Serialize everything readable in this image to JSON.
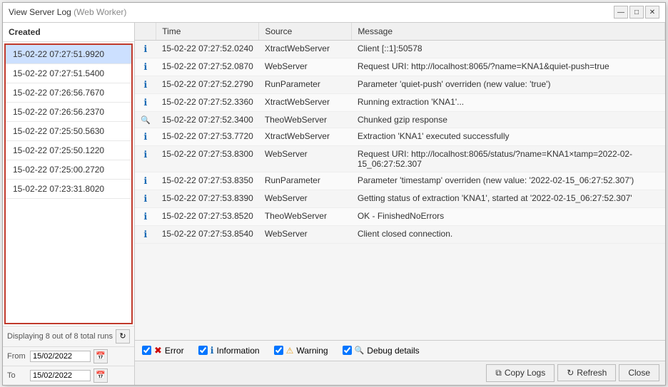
{
  "window": {
    "title": "View Server Log",
    "subtitle": "(Web Worker)"
  },
  "left_panel": {
    "header": "Created",
    "footer": "Displaying 8 out of 8 total runs",
    "runs": [
      {
        "id": 1,
        "label": "15-02-22 07:27:51.9920",
        "selected": true
      },
      {
        "id": 2,
        "label": "15-02-22 07:27:51.5400",
        "selected": false
      },
      {
        "id": 3,
        "label": "15-02-22 07:26:56.7670",
        "selected": false
      },
      {
        "id": 4,
        "label": "15-02-22 07:26:56.2370",
        "selected": false
      },
      {
        "id": 5,
        "label": "15-02-22 07:25:50.5630",
        "selected": false
      },
      {
        "id": 6,
        "label": "15-02-22 07:25:50.1220",
        "selected": false
      },
      {
        "id": 7,
        "label": "15-02-22 07:25:00.2720",
        "selected": false
      },
      {
        "id": 8,
        "label": "15-02-22 07:23:31.8020",
        "selected": false
      }
    ],
    "from_label": "From",
    "to_label": "To",
    "from_value": "15/02/2022",
    "to_value": "15/02/2022"
  },
  "log_table": {
    "columns": [
      "",
      "Time",
      "Source",
      "Message"
    ],
    "rows": [
      {
        "icon": "info",
        "time": "15-02-22 07:27:52.0240",
        "source": "XtractWebServer",
        "message": "Client [::1]:50578"
      },
      {
        "icon": "info",
        "time": "15-02-22 07:27:52.0870",
        "source": "WebServer",
        "message": "Request URI: http://localhost:8065/?name=KNA1&quiet-push=true"
      },
      {
        "icon": "info",
        "time": "15-02-22 07:27:52.2790",
        "source": "RunParameter",
        "message": "Parameter 'quiet-push' overriden (new value: 'true')"
      },
      {
        "icon": "info",
        "time": "15-02-22 07:27:52.3360",
        "source": "XtractWebServer",
        "message": "Running extraction 'KNA1'..."
      },
      {
        "icon": "search",
        "time": "15-02-22 07:27:52.3400",
        "source": "TheoWebServer",
        "message": "Chunked gzip response"
      },
      {
        "icon": "info",
        "time": "15-02-22 07:27:53.7720",
        "source": "XtractWebServer",
        "message": "Extraction 'KNA1' executed successfully"
      },
      {
        "icon": "info",
        "time": "15-02-22 07:27:53.8300",
        "source": "WebServer",
        "message": "Request URI: http://localhost:8065/status/?name=KNA1&timestamp=2022-02-15_06:27:52.307"
      },
      {
        "icon": "info",
        "time": "15-02-22 07:27:53.8350",
        "source": "RunParameter",
        "message": "Parameter 'timestamp' overriden (new value: '2022-02-15_06:27:52.307')"
      },
      {
        "icon": "info",
        "time": "15-02-22 07:27:53.8390",
        "source": "WebServer",
        "message": "Getting status of extraction 'KNA1', started at '2022-02-15_06:27:52.307'"
      },
      {
        "icon": "info",
        "time": "15-02-22 07:27:53.8520",
        "source": "TheoWebServer",
        "message": "OK - FinishedNoErrors"
      },
      {
        "icon": "info",
        "time": "15-02-22 07:27:53.8540",
        "source": "WebServer",
        "message": "Client closed connection."
      }
    ]
  },
  "filters": {
    "error": {
      "label": "Error",
      "checked": true
    },
    "information": {
      "label": "Information",
      "checked": true
    },
    "warning": {
      "label": "Warning",
      "checked": true
    },
    "debug": {
      "label": "Debug details",
      "checked": true
    }
  },
  "buttons": {
    "copy_logs": "Copy Logs",
    "refresh": "Refresh",
    "close": "Close"
  },
  "icons": {
    "minimize": "—",
    "maximize": "□",
    "close": "✕",
    "calendar": "📅",
    "refresh_small": "↻",
    "copy": "⧉",
    "refresh_btn": "↻"
  }
}
